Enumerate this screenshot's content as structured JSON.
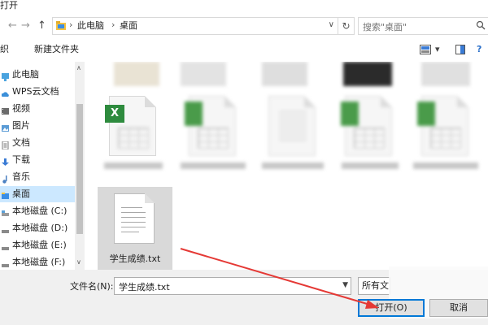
{
  "window": {
    "title": "打开"
  },
  "nav": {
    "back": "←",
    "forward": "→",
    "up": "↑"
  },
  "address": {
    "crumbs": [
      "此电脑",
      "桌面"
    ],
    "separator": "›",
    "dropdown": "∨",
    "refresh": "↻"
  },
  "search": {
    "placeholder": "搜索\"桌面\"",
    "icon": "search-icon"
  },
  "toolbar": {
    "organize": "织",
    "new_folder": "新建文件夹",
    "view_icon": "view-icon",
    "view_arrow": "▾",
    "pane_icon": "pane-icon",
    "help": "?"
  },
  "sidebar": {
    "items": [
      {
        "label": "此电脑",
        "icon": "computer-icon",
        "icon_color": "#4aa3df"
      },
      {
        "label": "WPS云文档",
        "icon": "cloud-icon",
        "icon_color": "#3b8fd9"
      },
      {
        "label": "视频",
        "icon": "video-icon",
        "icon_color": "#6b6b6b"
      },
      {
        "label": "图片",
        "icon": "picture-icon",
        "icon_color": "#5a9bd5"
      },
      {
        "label": "文档",
        "icon": "document-icon",
        "icon_color": "#7a7a7a"
      },
      {
        "label": "下载",
        "icon": "download-icon",
        "icon_color": "#3a7bd5"
      },
      {
        "label": "音乐",
        "icon": "music-icon",
        "icon_color": "#4a7fc1"
      },
      {
        "label": "桌面",
        "icon": "desktop-icon",
        "icon_color": "#3a8ee6",
        "selected": true
      },
      {
        "label": "本地磁盘 (C:)",
        "icon": "drive-icon",
        "icon_color": "#5aa0d8"
      },
      {
        "label": "本地磁盘 (D:)",
        "icon": "drive-icon",
        "icon_color": "#7a7a7a"
      },
      {
        "label": "本地磁盘 (E:)",
        "icon": "drive-icon",
        "icon_color": "#7a7a7a"
      },
      {
        "label": "本地磁盘 (F:)",
        "icon": "drive-icon",
        "icon_color": "#7a7a7a"
      }
    ],
    "scroll_up": "∧",
    "scroll_down": "∨"
  },
  "files": {
    "selected": {
      "name": "学生成绩.txt",
      "icon": "text-file-icon"
    }
  },
  "bottom": {
    "filename_label": "文件名(N):",
    "filename_value": "学生成绩.txt",
    "filetype_value": "所有文",
    "open_button": "打开(O)",
    "cancel_button": "取消"
  },
  "colors": {
    "selection": "#cce8ff",
    "accent": "#0078d7",
    "arrow": "#e53935",
    "excel_green": "#2e8b3e"
  }
}
